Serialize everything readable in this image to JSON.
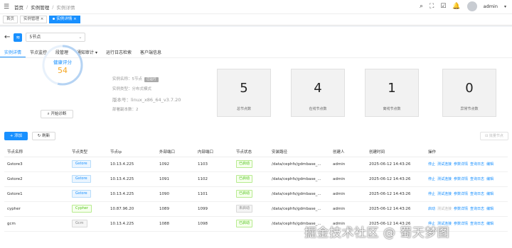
{
  "breadcrumb": [
    "首页",
    "实例管理",
    "实例详情"
  ],
  "user": {
    "name": "admin"
  },
  "tags": [
    {
      "label": "首页"
    },
    {
      "label": "实例管理 ×"
    },
    {
      "label": "实例详情 ×"
    }
  ],
  "instance": {
    "select_value": "5节点"
  },
  "tabs": [
    "实例详情",
    "节点监控",
    "段管理",
    "通知审计 ▾",
    "运行日志检索",
    "客户端信息"
  ],
  "health": {
    "label": "健康评分",
    "score": "54",
    "diag_button": "开始诊断"
  },
  "info": {
    "name": "实例名称：5节点",
    "name_badge": "已运行",
    "type": "实例类型：分布式模式",
    "version": "版本号：linux_x86_64_v3.7.20",
    "replica": "部署副本数：2"
  },
  "stats": [
    {
      "value": "5",
      "label": "总节点数"
    },
    {
      "value": "4",
      "label": "在线节点数"
    },
    {
      "value": "1",
      "label": "离线节点数"
    },
    {
      "value": "0",
      "label": "异常节点数"
    }
  ],
  "toolbar": {
    "add": "+ 添加",
    "refresh": "刷新",
    "export": "批量节点"
  },
  "table": {
    "headers": [
      "节点名称",
      "节点类型",
      "节点ip",
      "外部端口",
      "内部端口",
      "节点状态",
      "安装路径",
      "创建人",
      "创建时间",
      "操作"
    ],
    "rows": [
      {
        "name": "Gstore3",
        "type": "Gstore",
        "ip": "10.13.4.225",
        "ext": "1092",
        "int": "1103",
        "status": "已启动",
        "path": "/data/cephfs/gdmbase_...",
        "creator": "admin",
        "time": "2025-06-12 14:43:26",
        "ops": [
          "停止",
          "测试连接",
          "参数详情",
          "查询日志",
          "编辑"
        ]
      },
      {
        "name": "Gstore2",
        "type": "Gstore",
        "ip": "10.13.4.225",
        "ext": "1091",
        "int": "1102",
        "status": "已启动",
        "path": "/data/cephfs/gdmbase_...",
        "creator": "admin",
        "time": "2025-06-12 14:43:26",
        "ops": [
          "停止",
          "测试连接",
          "参数详情",
          "查询日志",
          "编辑"
        ]
      },
      {
        "name": "Gstore1",
        "type": "Gstore",
        "ip": "10.13.4.225",
        "ext": "1090",
        "int": "1101",
        "status": "已启动",
        "path": "/data/cephfs/gdmbase_...",
        "creator": "admin",
        "time": "2025-06-12 14:43:26",
        "ops": [
          "停止",
          "测试连接",
          "参数详情",
          "查询日志",
          "编辑"
        ]
      },
      {
        "name": "cypher",
        "type": "Cypher",
        "ip": "10.87.96.20",
        "ext": "1089",
        "int": "1099",
        "status": "未启动",
        "path": "/data/cephfs/gdmbase_...",
        "creator": "admin",
        "time": "2025-06-12 14:43:26",
        "ops": [
          "启动",
          "测试连接",
          "参数详情",
          "查询日志",
          "编辑"
        ]
      },
      {
        "name": "gcm",
        "type": "Gcm",
        "ip": "10.13.4.225",
        "ext": "1088",
        "int": "1098",
        "status": "已启动",
        "path": "/data/cephfs/gdmbase_...",
        "creator": "admin",
        "time": "2025-06-12 14:43:26",
        "ops": [
          "停止",
          "测试连接",
          "参数详情",
          "查询日志",
          "编辑"
        ]
      }
    ]
  },
  "watermark": "掘金技术社区 @ 蜀天梦图"
}
